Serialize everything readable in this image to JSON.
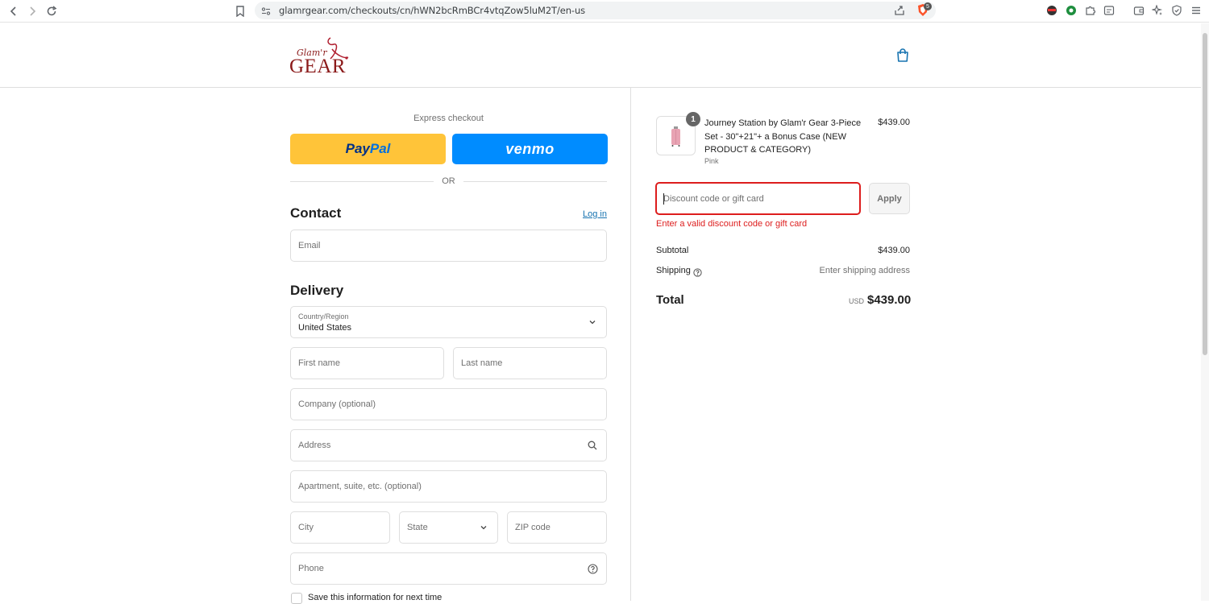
{
  "browser": {
    "url": "glamrgear.com/checkouts/cn/hWN2bcRmBCr4vtqZow5luM2T/en-us",
    "brave_badge": "5"
  },
  "header": {
    "logo_script": "Glam'r",
    "logo_word": "GEAR"
  },
  "express": {
    "label": "Express checkout",
    "paypal_part1": "Pay",
    "paypal_part2": "Pal",
    "venmo_label": "venmo",
    "or_label": "OR"
  },
  "contact": {
    "title": "Contact",
    "login_label": "Log in",
    "email_placeholder": "Email"
  },
  "delivery": {
    "title": "Delivery",
    "country_label": "Country/Region",
    "country_value": "United States",
    "first_name_placeholder": "First name",
    "last_name_placeholder": "Last name",
    "company_placeholder": "Company (optional)",
    "address_placeholder": "Address",
    "apartment_placeholder": "Apartment, suite, etc. (optional)",
    "city_placeholder": "City",
    "state_placeholder": "State",
    "zip_placeholder": "ZIP code",
    "phone_placeholder": "Phone",
    "save_info_label": "Save this information for next time"
  },
  "order": {
    "item": {
      "quantity": "1",
      "title": "Journey Station by Glam'r Gear 3-Piece Set - 30\"+21\"+ a Bonus Case (NEW PRODUCT & CATEGORY)",
      "variant": "Pink",
      "price": "$439.00"
    },
    "discount_placeholder": "Discount code or gift card",
    "apply_label": "Apply",
    "discount_error": "Enter a valid discount code or gift card",
    "subtotal_label": "Subtotal",
    "subtotal_value": "$439.00",
    "shipping_label": "Shipping",
    "shipping_value": "Enter shipping address",
    "total_label": "Total",
    "total_currency": "USD",
    "total_value": "$439.00"
  },
  "colors": {
    "accent": "#1773b0",
    "error": "#dd1d1d",
    "paypal_yellow": "#ffc439",
    "venmo_blue": "#008cff",
    "brand_red": "#8b1a1a"
  }
}
